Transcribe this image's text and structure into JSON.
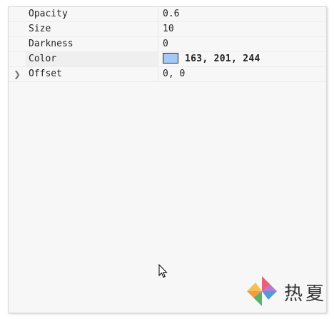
{
  "properties": [
    {
      "key": "Opacity",
      "value": "0.6"
    },
    {
      "key": "Size",
      "value": "10"
    },
    {
      "key": "Darkness",
      "value": "0"
    },
    {
      "key": "Color",
      "value": "163,  201,  244",
      "swatch": "#a3c9f4"
    },
    {
      "key": "Offset",
      "value": "0,  0",
      "expandable": true
    }
  ],
  "icons": {
    "expander": "chevron-right-icon",
    "cursor": "mouse-pointer-icon",
    "watermark": "pinwheel-logo-icon"
  },
  "watermark": {
    "text": "热夏"
  }
}
